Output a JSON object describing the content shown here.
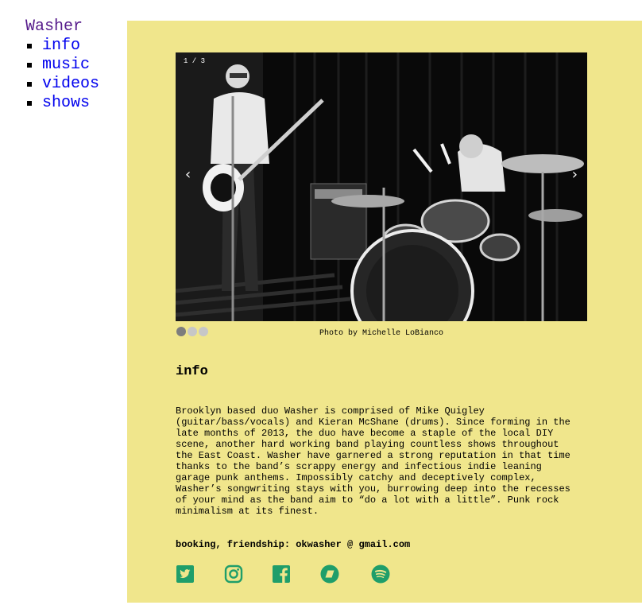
{
  "nav": {
    "site_title": "Washer",
    "items": [
      {
        "label": "info"
      },
      {
        "label": "music"
      },
      {
        "label": "videos"
      },
      {
        "label": "shows"
      }
    ]
  },
  "slideshow": {
    "counter": "1 / 3",
    "prev_icon": "‹",
    "next_icon": "›",
    "slide_count": 3,
    "active_slide": 1,
    "caption": "Photo by Michelle LoBianco"
  },
  "info": {
    "title": "info",
    "bio": "Brooklyn based duo Washer is comprised of Mike Quigley\n(guitar/bass/vocals) and Kieran McShane (drums). Since forming in the\nlate months of 2013, the duo have become a staple of the local DIY\nscene, another hard working band playing countless shows throughout\nthe East Coast. Washer have garnered a strong reputation in that time\nthanks to the band’s scrappy energy and infectious indie leaning\ngarage punk anthems. Impossibly catchy and deceptively complex,\nWasher’s songwriting stays with you, burrowing deep into the recesses\nof your mind as the band aim to “do a lot with a little”. Punk rock\nminimalism at its finest.",
    "contact": "booking, friendship: okwasher @ gmail.com"
  },
  "socials": [
    {
      "icon": "twitter-icon"
    },
    {
      "icon": "instagram-icon"
    },
    {
      "icon": "facebook-icon"
    },
    {
      "icon": "bandcamp-icon"
    },
    {
      "icon": "spotify-icon"
    }
  ],
  "colors": {
    "main_background": "#f0e68c",
    "social_icon": "#1f9e6a",
    "site_title": "#551a8b",
    "nav_link": "#0000ee"
  }
}
